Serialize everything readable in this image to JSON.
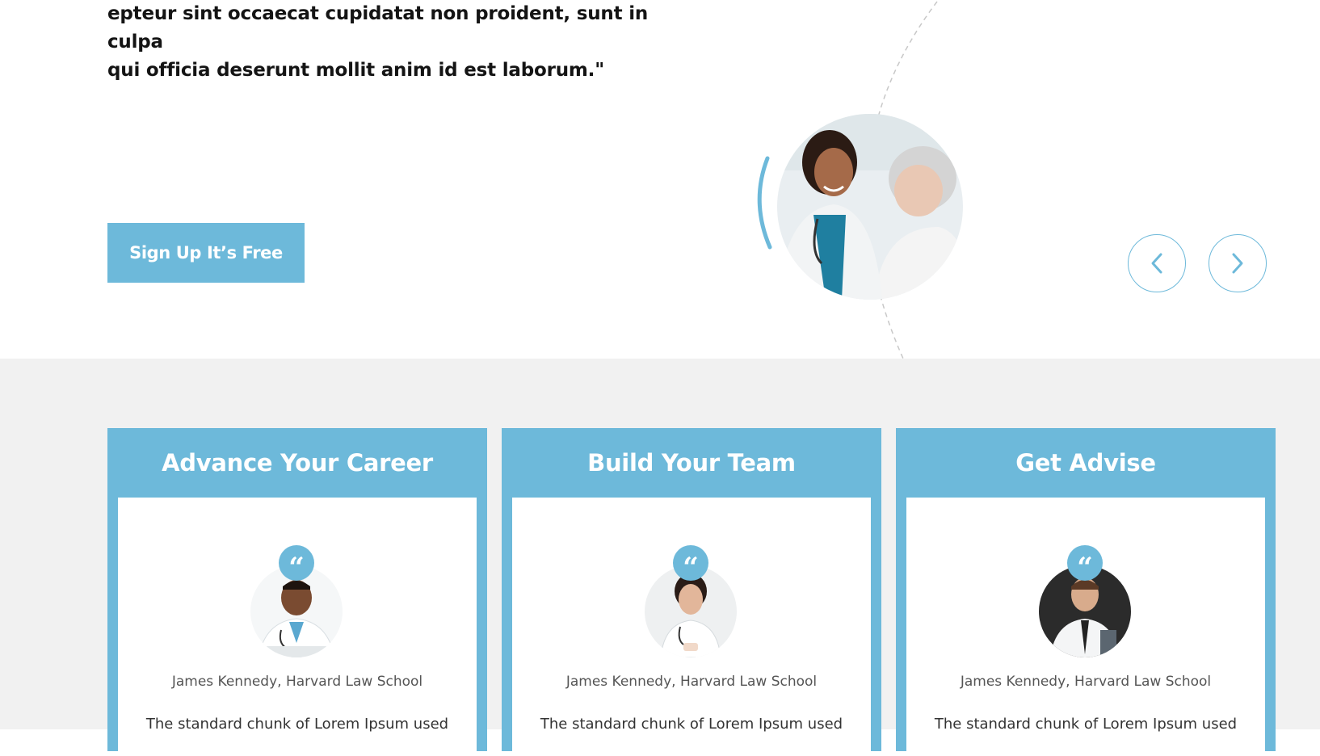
{
  "hero": {
    "quote_line1": "epteur sint occaecat cupidatat non proident, sunt in culpa",
    "quote_line2": "qui officia deserunt mollit anim id est laborum.\"",
    "signup_label": "Sign Up It’s Free",
    "photo_icon": "doctor-patient-photo",
    "prev_icon": "chevron-left-icon",
    "next_icon": "chevron-right-icon"
  },
  "cards": [
    {
      "title": "Advance Your Career",
      "author": "James Kennedy, Harvard Law School",
      "excerpt": "The standard chunk of Lorem Ipsum used",
      "avatar_icon": "male-doctor-avatar"
    },
    {
      "title": "Build Your Team",
      "author": "James Kennedy, Harvard Law School",
      "excerpt": "The standard chunk of Lorem Ipsum used",
      "avatar_icon": "female-nurse-avatar"
    },
    {
      "title": "Get Advise",
      "author": "James Kennedy, Harvard Law School",
      "excerpt": "The standard chunk of Lorem Ipsum used",
      "avatar_icon": "male-doctor-tie-avatar"
    }
  ],
  "colors": {
    "accent": "#6db9da",
    "section_bg": "#f1f1f1",
    "text_dark": "#141414",
    "text_muted": "#555555"
  }
}
